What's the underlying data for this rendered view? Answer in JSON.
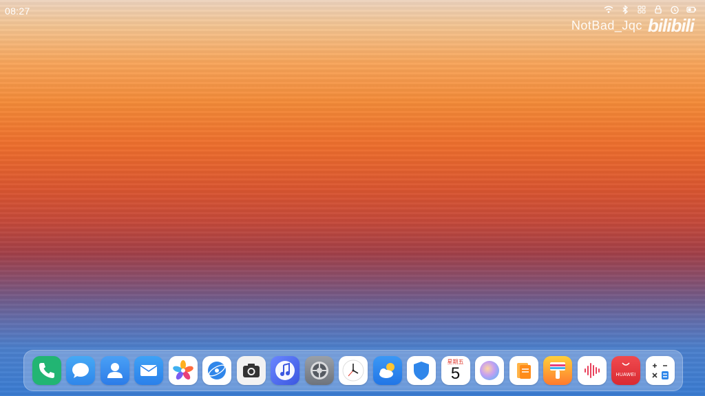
{
  "status_bar": {
    "time": "08:27",
    "icons": [
      "wifi-icon",
      "bluetooth-icon",
      "grid-icon",
      "lock-icon",
      "alarm-icon",
      "battery-icon"
    ]
  },
  "watermark": {
    "username": "NotBad_Jqc",
    "logo": "bilibili"
  },
  "dock": {
    "apps": [
      {
        "name": "phone",
        "icon": "phone-icon",
        "color": "#22b573"
      },
      {
        "name": "messages",
        "icon": "message-icon",
        "color": "#3c9bf0"
      },
      {
        "name": "contacts",
        "icon": "contacts-icon",
        "color": "#3b8ef0"
      },
      {
        "name": "email",
        "icon": "email-icon",
        "color": "#2f8ef2"
      },
      {
        "name": "gallery",
        "icon": "gallery-icon",
        "color": "#ffffff"
      },
      {
        "name": "browser",
        "icon": "browser-icon",
        "color": "#ffffff"
      },
      {
        "name": "camera",
        "icon": "camera-icon",
        "color": "#f2f2f2"
      },
      {
        "name": "music",
        "icon": "music-icon",
        "color": "#4a6cf0"
      },
      {
        "name": "settings",
        "icon": "settings-icon",
        "color": "#8a8f98"
      },
      {
        "name": "clock",
        "icon": "clock-icon",
        "color": "#ffffff"
      },
      {
        "name": "weather",
        "icon": "weather-icon",
        "color": "#2f87f3"
      },
      {
        "name": "security",
        "icon": "shield-icon",
        "color": "#ffffff"
      },
      {
        "name": "calendar",
        "icon": "calendar-icon",
        "color": "#ffffff",
        "weekday": "星期五",
        "date": "5"
      },
      {
        "name": "themes",
        "icon": "themes-icon",
        "color": "#ffffff"
      },
      {
        "name": "files",
        "icon": "files-icon",
        "color": "#ffffff"
      },
      {
        "name": "tips",
        "icon": "brush-icon",
        "color": "#ff8a3c"
      },
      {
        "name": "recorder",
        "icon": "recorder-icon",
        "color": "#ffffff"
      },
      {
        "name": "appgallery",
        "icon": "appgallery-icon",
        "color": "#e8373d",
        "label": "HUAWEI"
      },
      {
        "name": "calculator",
        "icon": "calculator-icon",
        "color": "#ffffff"
      }
    ]
  }
}
